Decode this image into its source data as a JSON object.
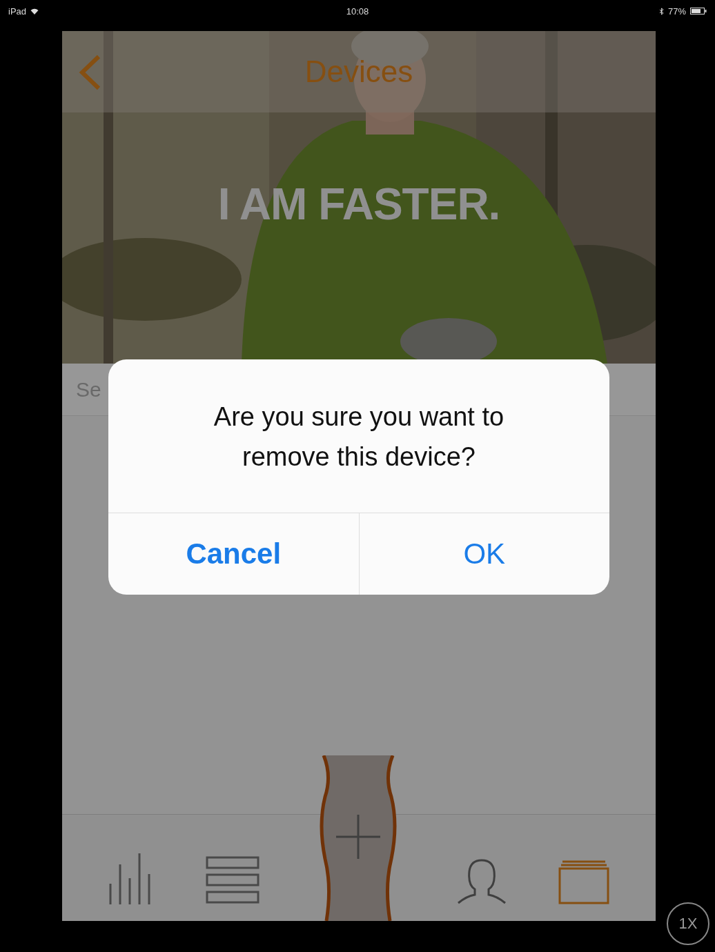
{
  "status_bar": {
    "device": "iPad",
    "time": "10:08",
    "battery": "77%"
  },
  "nav": {
    "title": "Devices"
  },
  "banner": {
    "headline": "I AM FASTER."
  },
  "search": {
    "placeholder": "Se"
  },
  "dialog": {
    "message": "Are you sure you want to remove this device?",
    "buttons": [
      {
        "label": "Cancel",
        "kind": "cancel"
      },
      {
        "label": "OK",
        "kind": "ok"
      }
    ]
  },
  "tabs": [
    {
      "kind": "stats",
      "selected": false
    },
    {
      "kind": "list",
      "selected": false
    },
    {
      "kind": "add",
      "selected": false
    },
    {
      "kind": "profile",
      "selected": false
    },
    {
      "kind": "devices",
      "selected": true
    }
  ],
  "zoom_button": "1X"
}
